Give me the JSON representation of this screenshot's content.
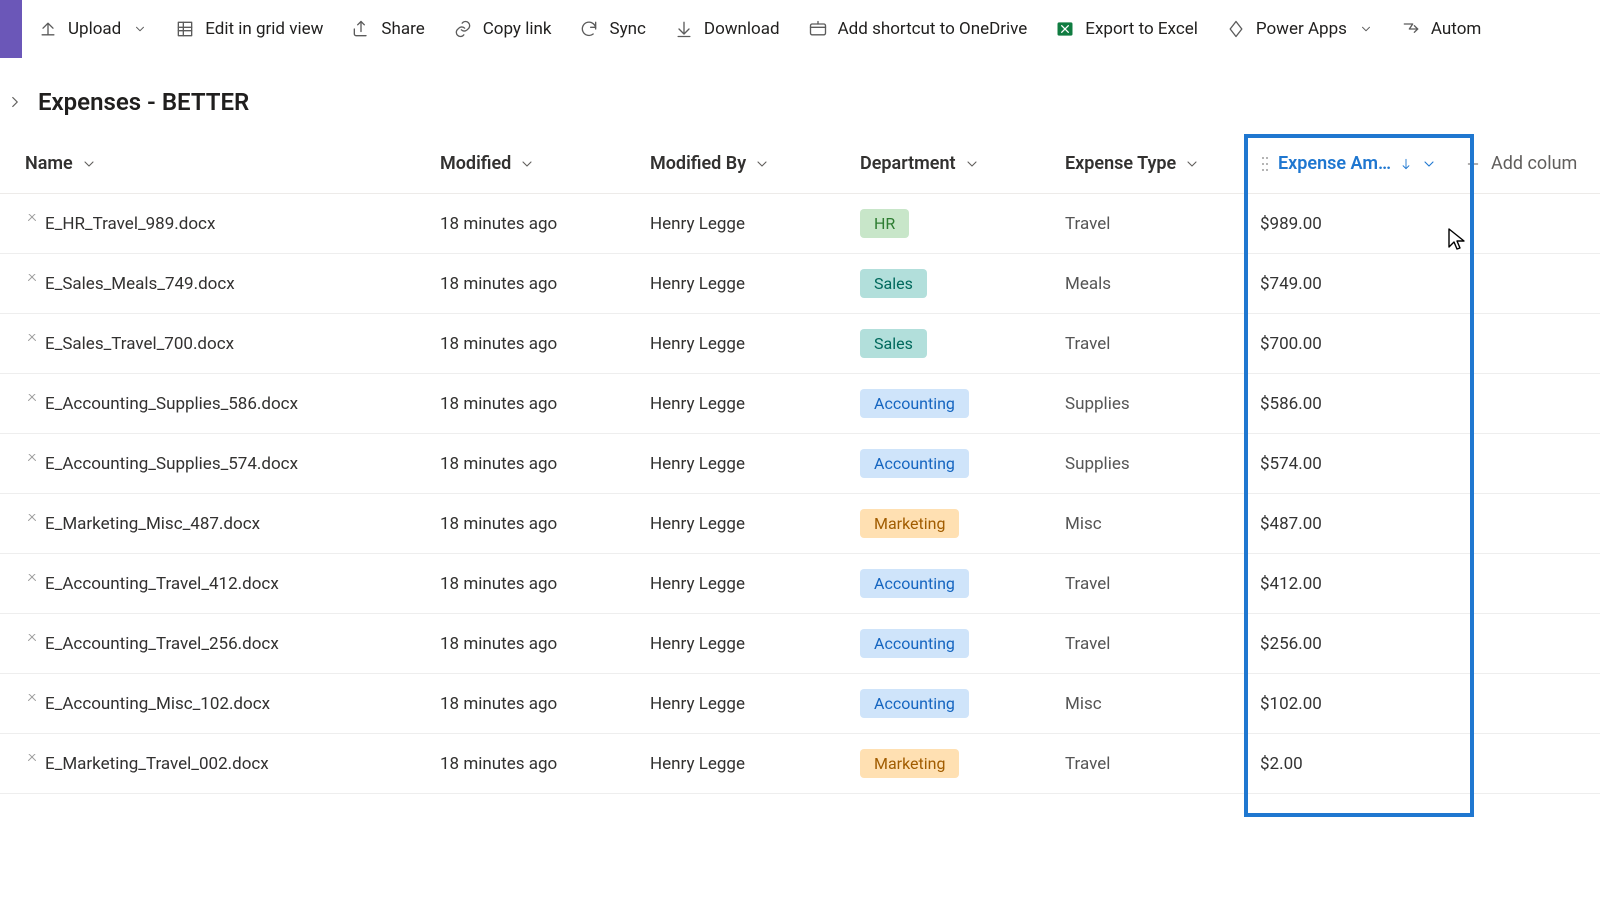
{
  "commands": {
    "upload": "Upload",
    "editgrid": "Edit in grid view",
    "share": "Share",
    "copylink": "Copy link",
    "sync": "Sync",
    "download": "Download",
    "addshortcut": "Add shortcut to OneDrive",
    "exportexcel": "Export to Excel",
    "powerapps": "Power Apps",
    "automate": "Autom"
  },
  "breadcrumb": {
    "title": "Expenses - BETTER"
  },
  "columns": {
    "name": "Name",
    "modified": "Modified",
    "modifiedby": "Modified By",
    "department": "Department",
    "expensetype": "Expense Type",
    "expenseamount": "Expense Am…",
    "addcolumn": "Add colum"
  },
  "rows": [
    {
      "name": "E_HR_Travel_989.docx",
      "modified": "18 minutes ago",
      "by": "Henry Legge",
      "dept": "HR",
      "dept_class": "hr",
      "etype": "Travel",
      "amount": "$989.00"
    },
    {
      "name": "E_Sales_Meals_749.docx",
      "modified": "18 minutes ago",
      "by": "Henry Legge",
      "dept": "Sales",
      "dept_class": "sales",
      "etype": "Meals",
      "amount": "$749.00"
    },
    {
      "name": "E_Sales_Travel_700.docx",
      "modified": "18 minutes ago",
      "by": "Henry Legge",
      "dept": "Sales",
      "dept_class": "sales",
      "etype": "Travel",
      "amount": "$700.00"
    },
    {
      "name": "E_Accounting_Supplies_586.docx",
      "modified": "18 minutes ago",
      "by": "Henry Legge",
      "dept": "Accounting",
      "dept_class": "accounting",
      "etype": "Supplies",
      "amount": "$586.00"
    },
    {
      "name": "E_Accounting_Supplies_574.docx",
      "modified": "18 minutes ago",
      "by": "Henry Legge",
      "dept": "Accounting",
      "dept_class": "accounting",
      "etype": "Supplies",
      "amount": "$574.00"
    },
    {
      "name": "E_Marketing_Misc_487.docx",
      "modified": "18 minutes ago",
      "by": "Henry Legge",
      "dept": "Marketing",
      "dept_class": "marketing",
      "etype": "Misc",
      "amount": "$487.00"
    },
    {
      "name": "E_Accounting_Travel_412.docx",
      "modified": "18 minutes ago",
      "by": "Henry Legge",
      "dept": "Accounting",
      "dept_class": "accounting",
      "etype": "Travel",
      "amount": "$412.00"
    },
    {
      "name": "E_Accounting_Travel_256.docx",
      "modified": "18 minutes ago",
      "by": "Henry Legge",
      "dept": "Accounting",
      "dept_class": "accounting",
      "etype": "Travel",
      "amount": "$256.00"
    },
    {
      "name": "E_Accounting_Misc_102.docx",
      "modified": "18 minutes ago",
      "by": "Henry Legge",
      "dept": "Accounting",
      "dept_class": "accounting",
      "etype": "Misc",
      "amount": "$102.00"
    },
    {
      "name": "E_Marketing_Travel_002.docx",
      "modified": "18 minutes ago",
      "by": "Henry Legge",
      "dept": "Marketing",
      "dept_class": "marketing",
      "etype": "Travel",
      "amount": "$2.00"
    }
  ]
}
